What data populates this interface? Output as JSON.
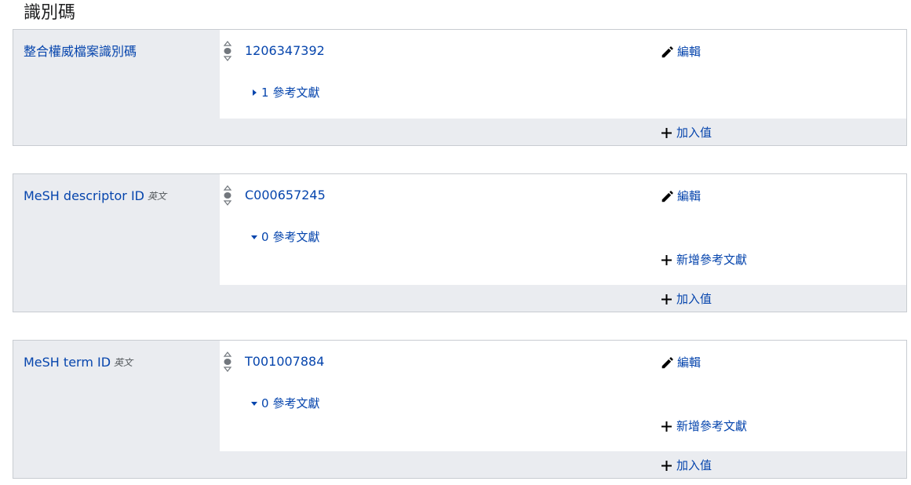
{
  "section": {
    "title": "識別碼"
  },
  "labels": {
    "edit": "編輯",
    "add_reference": "新增參考文獻",
    "add_value": "加入值"
  },
  "statements": [
    {
      "property": "整合權威檔案識別碼",
      "lang_indicator": "",
      "value": "1206347392",
      "references": {
        "count": "1",
        "label": "參考文獻",
        "expanded": false
      }
    },
    {
      "property": "MeSH descriptor ID",
      "lang_indicator": "英文",
      "value": "C000657245",
      "references": {
        "count": "0",
        "label": "參考文獻",
        "expanded": true
      }
    },
    {
      "property": "MeSH term ID",
      "lang_indicator": "英文",
      "value": "T001007884",
      "references": {
        "count": "0",
        "label": "參考文獻",
        "expanded": true
      }
    }
  ],
  "colors": {
    "link": "#0645ad",
    "panel_bg": "#eaecf0",
    "border": "#c8ccd1",
    "text": "#202122"
  },
  "icons": [
    "rank-normal-icon",
    "pencil-icon",
    "triangle-right-icon",
    "triangle-down-icon",
    "plus-icon"
  ]
}
